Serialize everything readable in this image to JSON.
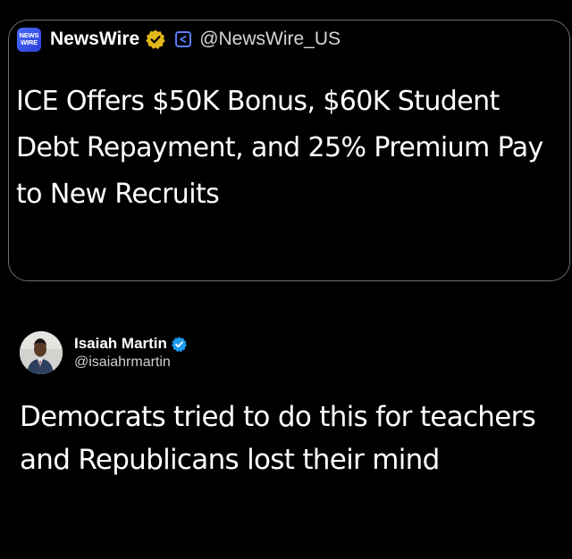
{
  "quoted_post": {
    "logo_line1": "NEWS",
    "logo_line2": "WIRE",
    "account_name": "NewsWire",
    "handle": "@NewsWire_US",
    "headline": "ICE Offers $50K Bonus, $60K Student Debt Repayment, and 25% Premium Pay to New Recruits",
    "verified_badge_icon": "gold-verified-badge-icon",
    "affiliate_icon": "organization-affiliate-icon",
    "colors": {
      "gold_badge": "#e2b719",
      "logo_blue": "#3b55f0"
    }
  },
  "post": {
    "author_name": "Isaiah Martin",
    "author_handle": "@isaiahrmartin",
    "verified_badge_icon": "blue-verified-badge-icon",
    "body": "Democrats tried to do this for teachers and Republicans lost their mind",
    "colors": {
      "blue_badge": "#1d9bf0"
    }
  },
  "theme": {
    "background": "#000000",
    "text": "#ffffff",
    "border": "#6e6e6e"
  }
}
